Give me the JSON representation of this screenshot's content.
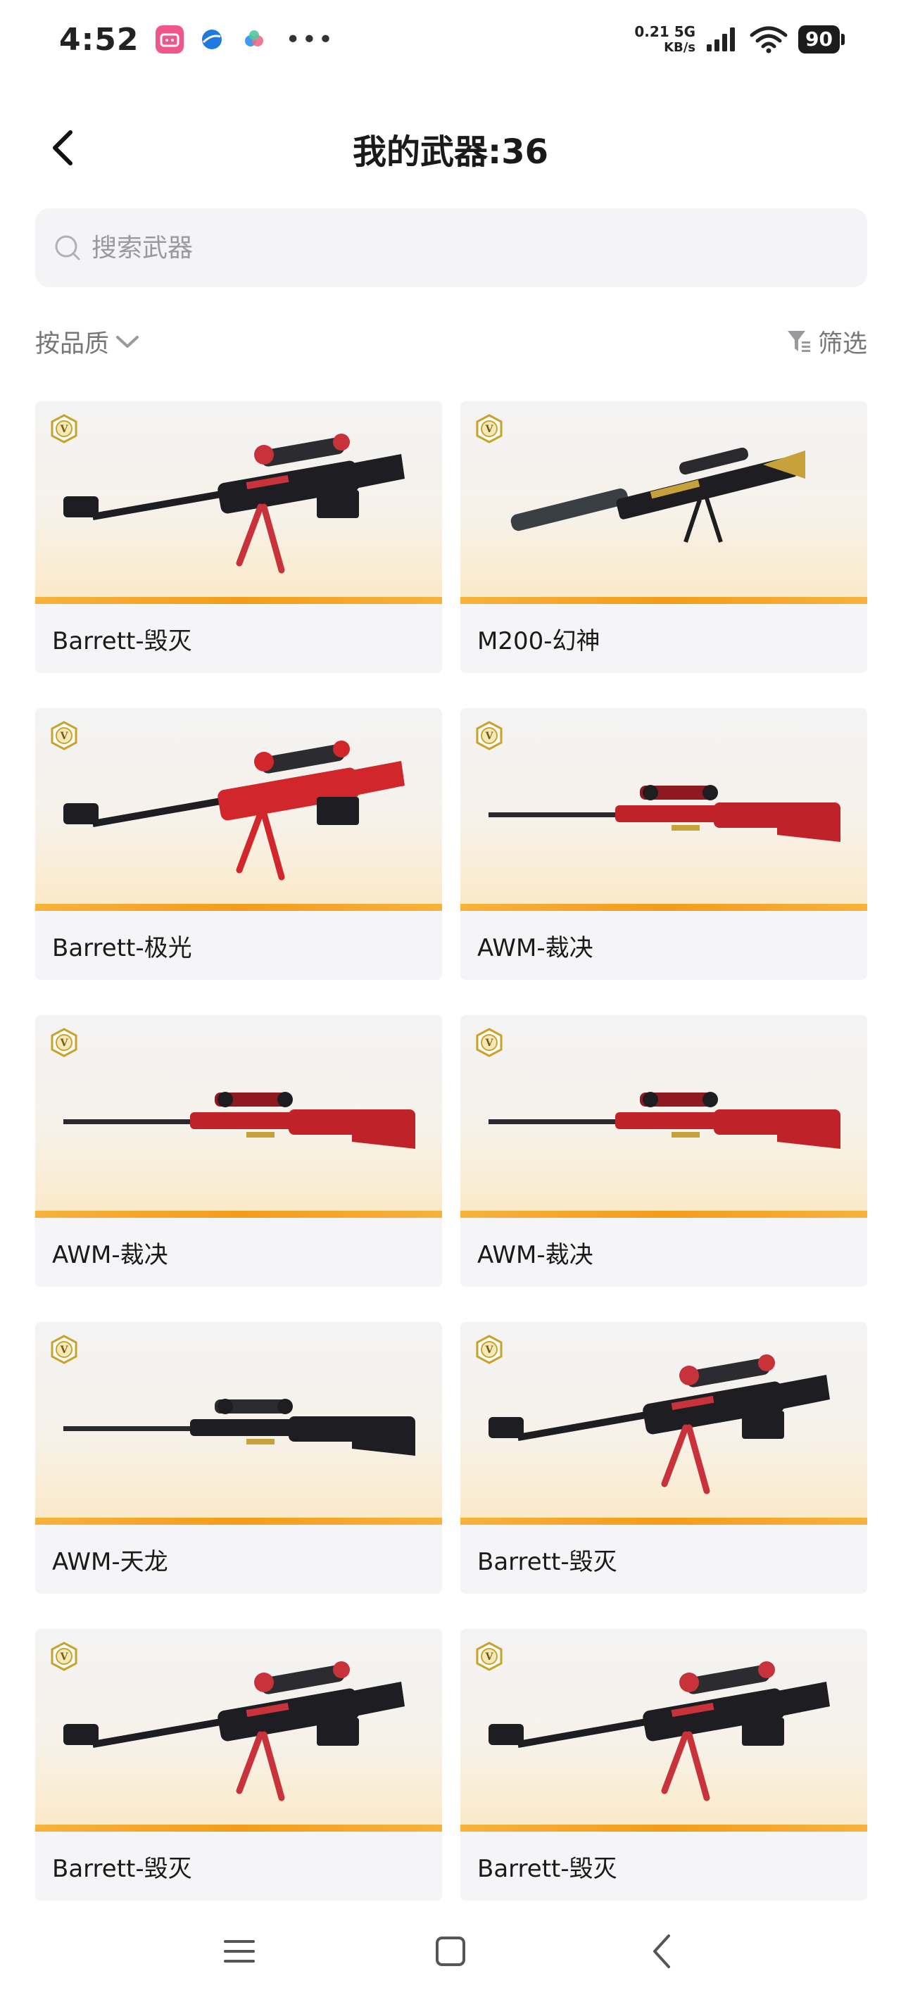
{
  "status_bar": {
    "time": "4:52",
    "net_speed_value": "0.21 5G",
    "net_speed_unit": "KB/s",
    "battery": "90",
    "more_dots": "•••"
  },
  "header": {
    "title": "我的武器:36"
  },
  "search": {
    "placeholder": "搜索武器",
    "value": ""
  },
  "controls": {
    "sort_label": "按品质",
    "filter_label": "筛选"
  },
  "weapons": [
    {
      "name": "Barrett-毁灭",
      "art": "barrett",
      "color": "#c8323a"
    },
    {
      "name": "M200-幻神",
      "art": "m200",
      "color": "#c7a23a"
    },
    {
      "name": "Barrett-极光",
      "art": "barrett-red",
      "color": "#d1262c"
    },
    {
      "name": "AWM-裁决",
      "art": "awm",
      "color": "#c0222a"
    },
    {
      "name": "AWM-裁决",
      "art": "awm",
      "color": "#c0222a"
    },
    {
      "name": "AWM-裁决",
      "art": "awm",
      "color": "#c0222a"
    },
    {
      "name": "AWM-天龙",
      "art": "awm-dark",
      "color": "#c7a23a"
    },
    {
      "name": "Barrett-毁灭",
      "art": "barrett",
      "color": "#c8323a"
    },
    {
      "name": "Barrett-毁灭",
      "art": "barrett",
      "color": "#c8323a"
    },
    {
      "name": "Barrett-毁灭",
      "art": "barrett",
      "color": "#c8323a"
    }
  ],
  "colors": {
    "accent_bar": "#f39c1b",
    "badge_gold": "#c9a227"
  },
  "icons": {
    "back": "back-arrow-icon",
    "search": "search-icon",
    "sort": "chevron-down-icon",
    "filter": "filter-icon",
    "badge": "quality-v-badge-icon"
  }
}
